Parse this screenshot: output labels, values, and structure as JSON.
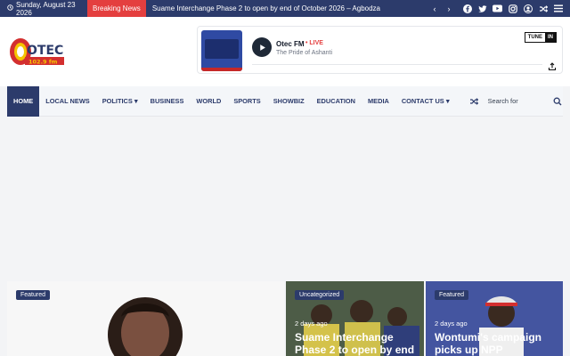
{
  "topbar": {
    "date": "Sunday, August 23 2026",
    "breaking_label": "Breaking News",
    "ticker": "Suame Interchange Phase 2 to open by end of October 2026 – Agbodza",
    "arrows": [
      "‹",
      "›"
    ],
    "social_icons": [
      "facebook-icon",
      "twitter-icon",
      "youtube-icon",
      "instagram-icon",
      "user-icon",
      "shuffle-icon",
      "menu-icon"
    ]
  },
  "logo": {
    "brand": "OTEC",
    "frequency": "102.9 fm"
  },
  "player": {
    "station_name": "Otec FM",
    "live_label": "LIVE",
    "tagline": "The Pride of Ashanti",
    "tunein_a": "TUNE",
    "tunein_b": "IN"
  },
  "nav": {
    "items": [
      {
        "label": "HOME"
      },
      {
        "label": "LOCAL NEWS"
      },
      {
        "label": "POLITICS",
        "dropdown": true
      },
      {
        "label": "BUSINESS"
      },
      {
        "label": "WORLD"
      },
      {
        "label": "SPORTS"
      },
      {
        "label": "SHOWBIZ"
      },
      {
        "label": "EDUCATION"
      },
      {
        "label": "MEDIA"
      },
      {
        "label": "CONTACT US",
        "dropdown": true
      }
    ],
    "search_placeholder": "Search for"
  },
  "cards": [
    {
      "badge": "Featured",
      "meta": "",
      "title": ""
    },
    {
      "badge": "Uncategorized",
      "meta": "2 days ago",
      "title": "Suame Interchange Phase 2 to open by end"
    },
    {
      "badge": "Featured",
      "meta": "2 days ago",
      "title": "Wontumi's campaign picks up NPP"
    }
  ],
  "colors": {
    "brand_navy": "#2c3b6b",
    "breaking_red": "#e43f3f",
    "logo_red": "#d32f2f",
    "logo_yellow": "#f5c400"
  }
}
